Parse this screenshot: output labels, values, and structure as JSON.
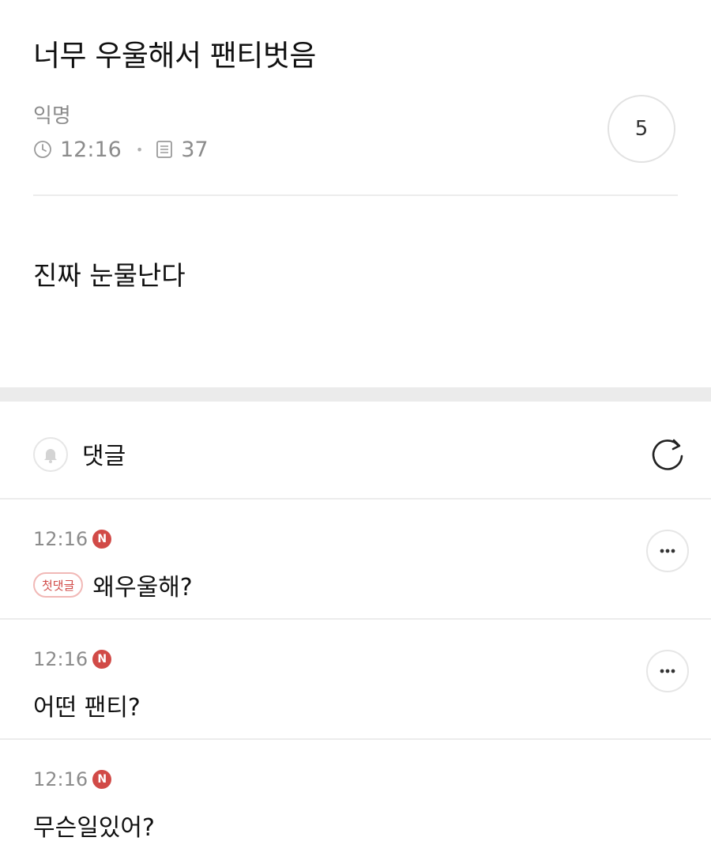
{
  "post": {
    "title": "너무 우울해서 팬티벗음",
    "author": "익명",
    "time": "12:16",
    "views": "37",
    "comment_count": "5",
    "body": "진짜 눈물난다"
  },
  "comments_section": {
    "label": "댓글"
  },
  "comments": [
    {
      "time": "12:16",
      "new_badge": "N",
      "tag": "첫댓글",
      "text": "왜우울해?"
    },
    {
      "time": "12:16",
      "new_badge": "N",
      "text": "어떤 팬티?"
    },
    {
      "time": "12:16",
      "new_badge": "N",
      "text": "무슨일있어?"
    }
  ],
  "icons": {
    "clock": "clock-icon",
    "views": "document-icon",
    "bell": "bell-icon",
    "refresh": "refresh-icon",
    "more": "more-icon"
  },
  "colors": {
    "accent": "#d14a47",
    "muted_text": "#8c8c8c",
    "divider": "#ececec"
  }
}
